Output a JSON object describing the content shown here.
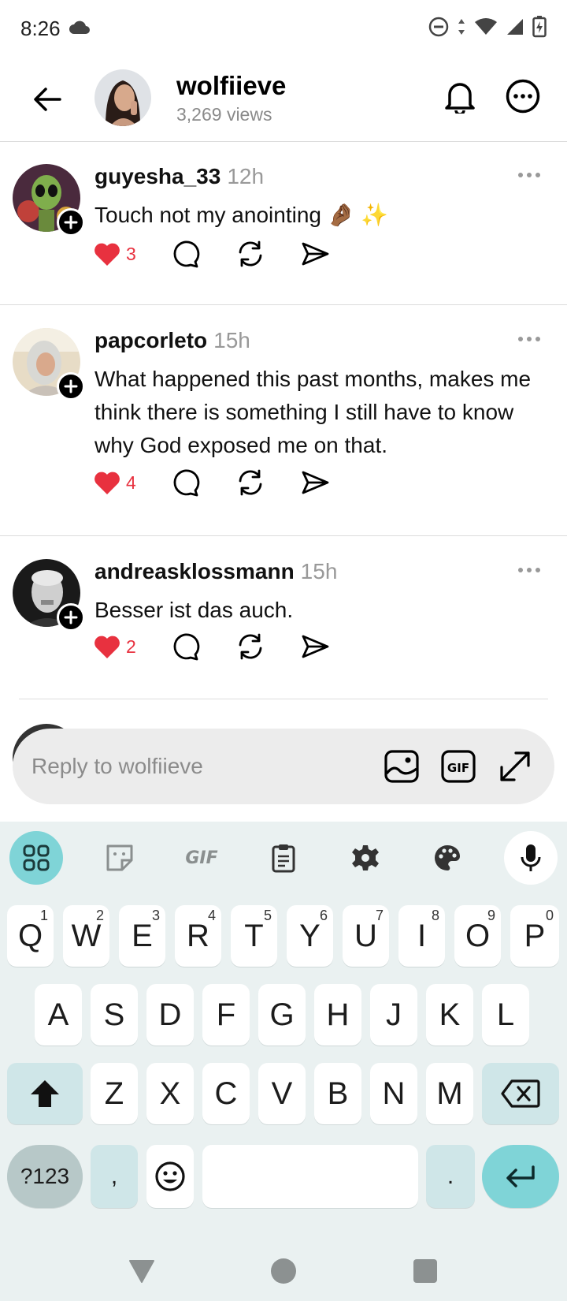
{
  "status_bar": {
    "time": "8:26"
  },
  "header": {
    "username": "wolfiieve",
    "views": "3,269 views"
  },
  "posts": [
    {
      "username": "guyesha_33",
      "time": "12h",
      "content": "Touch not my anointing 🤌🏾 ✨",
      "likes": "3"
    },
    {
      "username": "papcorleto",
      "time": "15h",
      "content": "What happened this past months, makes me think there is something I still have to know why God exposed me on that.",
      "likes": "4"
    },
    {
      "username": "andreasklossmann",
      "time": "15h",
      "content": "Besser ist das auch.",
      "likes": "2"
    }
  ],
  "reply": {
    "placeholder": "Reply to wolfiieve"
  },
  "keyboard": {
    "toolbar": [
      "apps-icon",
      "sticker-icon",
      "gif-icon",
      "clipboard-icon",
      "settings-icon",
      "theme-icon",
      "mic-icon"
    ],
    "gif_label": "GIF",
    "row1": [
      {
        "k": "Q",
        "h": "1"
      },
      {
        "k": "W",
        "h": "2"
      },
      {
        "k": "E",
        "h": "3"
      },
      {
        "k": "R",
        "h": "4"
      },
      {
        "k": "T",
        "h": "5"
      },
      {
        "k": "Y",
        "h": "6"
      },
      {
        "k": "U",
        "h": "7"
      },
      {
        "k": "I",
        "h": "8"
      },
      {
        "k": "O",
        "h": "9"
      },
      {
        "k": "P",
        "h": "0"
      }
    ],
    "row2": [
      "A",
      "S",
      "D",
      "F",
      "G",
      "H",
      "J",
      "K",
      "L"
    ],
    "row3": [
      "Z",
      "X",
      "C",
      "V",
      "B",
      "N",
      "M"
    ],
    "sym_label": "?123",
    "comma": ",",
    "period": "."
  },
  "colors": {
    "like": "#e8313f",
    "accent": "#7fd4d7",
    "keyboard_bg": "#eaf1f1"
  }
}
